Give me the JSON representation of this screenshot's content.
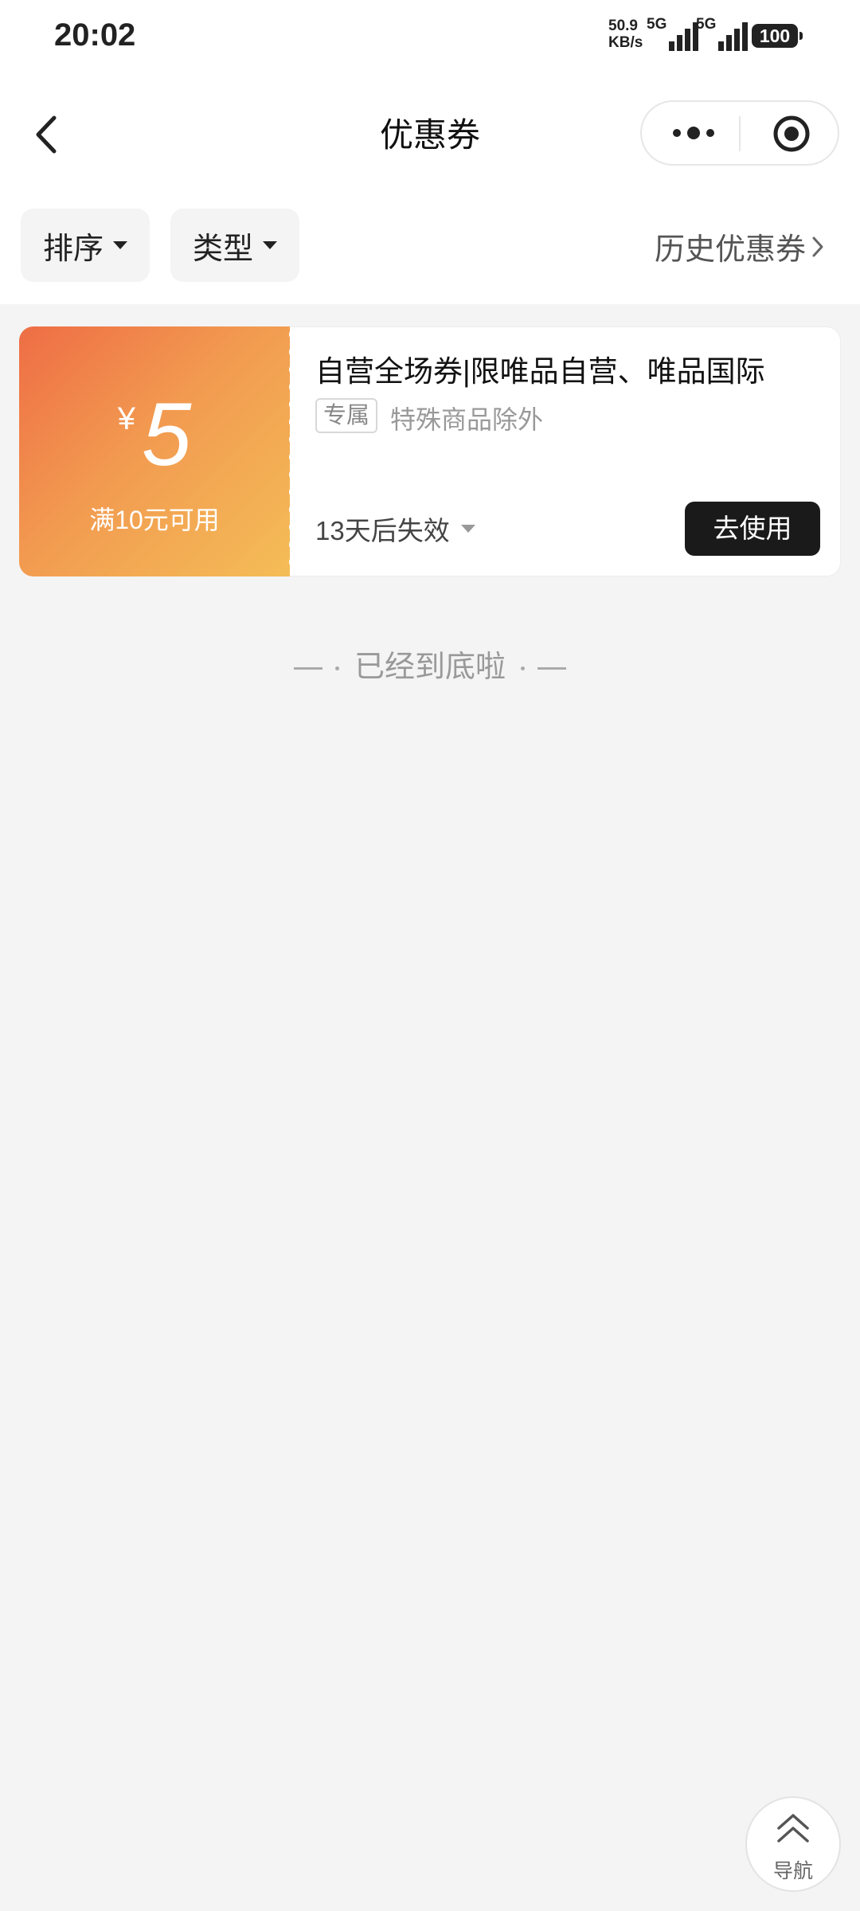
{
  "status_bar": {
    "time": "20:02",
    "net_speed_value": "50.9",
    "net_speed_unit": "KB/s",
    "signal_1": "5G",
    "signal_2": "5G",
    "battery": "100"
  },
  "nav": {
    "title": "优惠券",
    "back_icon": "chevron-left-icon",
    "more_icon": "more-dots-icon",
    "close_icon": "target-close-icon"
  },
  "filters": {
    "sort_label": "排序",
    "type_label": "类型",
    "history_label": "历史优惠券"
  },
  "coupon": {
    "currency": "¥",
    "amount": "5",
    "threshold": "满10元可用",
    "title": "自营全场券|限唯品自营、唯品国际",
    "tag": "专属",
    "restriction": "特殊商品除外",
    "expire": "13天后失效",
    "use_button": "去使用",
    "gradient_start": "#ee6d45",
    "gradient_end": "#f4bd57"
  },
  "end_marker": "已经到底啦",
  "float_nav": {
    "label": "导航",
    "icon": "double-chevron-up-icon"
  }
}
